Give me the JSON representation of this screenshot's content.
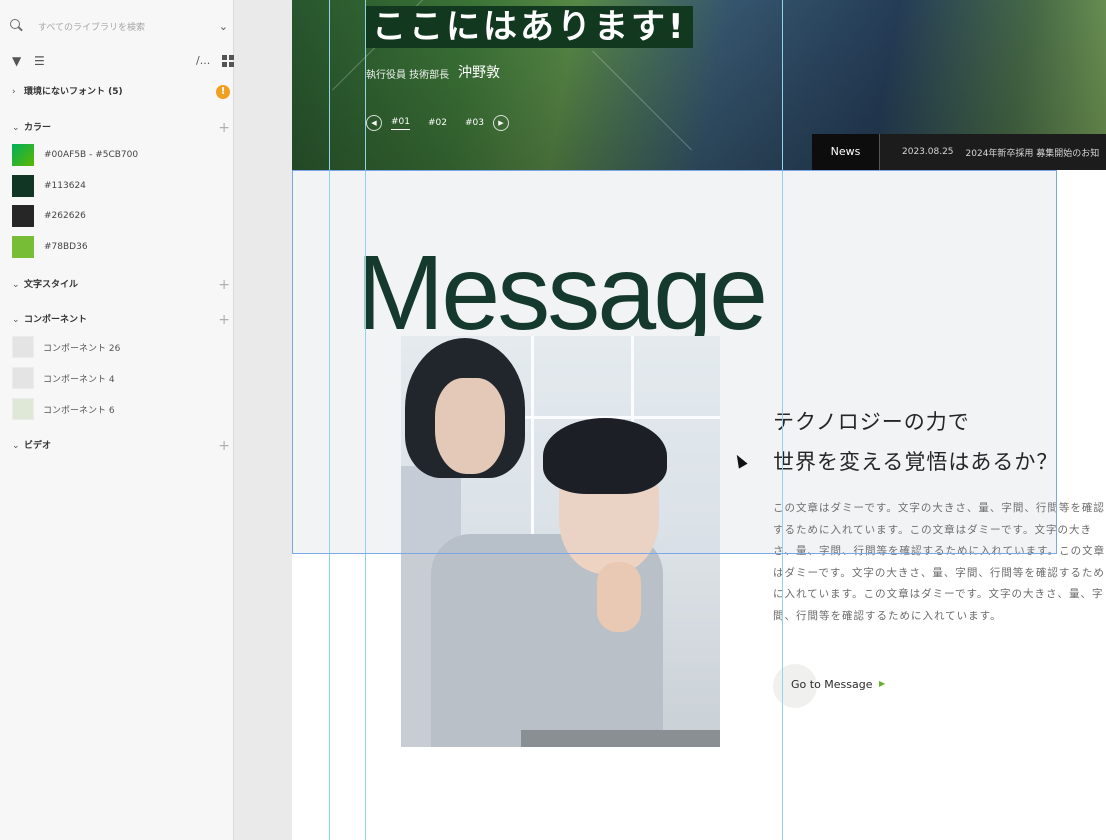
{
  "library_panel": {
    "search_placeholder": "すべてのライブラリを検索",
    "toolbar": {
      "filter_icon": "filter-icon",
      "sort_icon": "sort-icon",
      "path_text": "/...",
      "view_icon": "grid-view-icon"
    },
    "missing_fonts": {
      "label": "環境にないフォント (5)",
      "warning": "!"
    },
    "colors": {
      "label": "カラー",
      "items": [
        {
          "label": "#00AF5B - #5CB700",
          "swatch": "#2fb34a"
        },
        {
          "label": "#113624",
          "swatch": "#113624"
        },
        {
          "label": "#262626",
          "swatch": "#262626"
        },
        {
          "label": "#78BD36",
          "swatch": "#78bd36"
        }
      ]
    },
    "text_styles": {
      "label": "文字スタイル"
    },
    "components": {
      "label": "コンポーネント",
      "items": [
        {
          "label": "コンポーネント 26"
        },
        {
          "label": "コンポーネント 4"
        },
        {
          "label": "コンポーネント 6"
        }
      ]
    },
    "video": {
      "label": "ビデオ"
    }
  },
  "canvas": {
    "hero": {
      "title": "ここにはあります!",
      "role": "執行役員 技術部長",
      "name": "沖野敦",
      "slides": [
        "#01",
        "#02",
        "#03"
      ],
      "active_slide": "#01",
      "news_label": "News",
      "news_date": "2023.08.25",
      "news_text": "2024年新卒採用 募集開始のお知"
    },
    "message": {
      "heading": "Message",
      "catch_line1": "テクノロジーの力で",
      "catch_line2": "世界を変える覚悟はあるか？",
      "body": "この文章はダミーです。文字の大きさ、量、字間、行間等を確認するために入れています。この文章はダミーです。文字の大きさ、量、字間、行間等を確認するために入れています。この文章はダミーです。文字の大きさ、量、字間、行間等を確認するために入れています。この文章はダミーです。文字の大きさ、量、字間、行間等を確認するために入れています。",
      "button": "Go to Message"
    },
    "colors": {
      "heading": "#0e3323",
      "accent": "#6ab02c",
      "selection": "#7ca6e8",
      "guide": "#8fd5ea"
    }
  }
}
